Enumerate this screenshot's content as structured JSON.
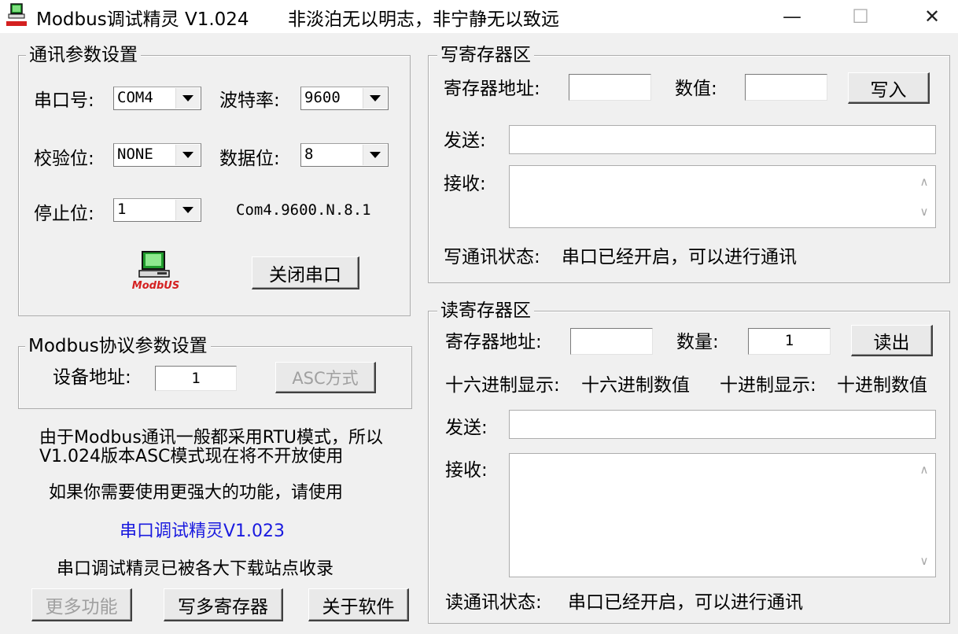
{
  "window": {
    "title": "Modbus调试精灵 V1.024",
    "motto": "非淡泊无以明志，非宁静无以致远",
    "minimize_symbol": "—",
    "maximize_symbol": "☐",
    "close_symbol": "✕"
  },
  "comm": {
    "legend": "通讯参数设置",
    "port_label": "串口号:",
    "port_value": "COM4",
    "baud_label": "波特率:",
    "baud_value": "9600",
    "parity_label": "校验位:",
    "parity_value": "NONE",
    "databits_label": "数据位:",
    "databits_value": "8",
    "stopbits_label": "停止位:",
    "stopbits_value": "1",
    "summary": "Com4.9600.N.8.1",
    "logo_text": "ModbUS",
    "close_port_label": "关闭串口"
  },
  "protocol": {
    "legend": "Modbus协议参数设置",
    "device_addr_label": "设备地址:",
    "device_addr_value": "1",
    "asc_button_label": "ASC方式"
  },
  "notes": {
    "line1": "由于Modbus通讯一般都采用RTU模式，所以",
    "line2": "V1.024版本ASC模式现在将不开放使用",
    "line3": "如果你需要使用更强大的功能，请使用",
    "link": "串口调试精灵V1.023",
    "line4": "串口调试精灵已被各大下载站点收录"
  },
  "bottom_buttons": {
    "more": "更多功能",
    "write_multi": "写多寄存器",
    "about": "关于软件"
  },
  "write": {
    "legend": "写寄存器区",
    "addr_label": "寄存器地址:",
    "addr_value": "",
    "value_label": "数值:",
    "value_value": "",
    "write_button": "写入",
    "send_label": "发送:",
    "send_value": "",
    "recv_label": "接收:",
    "recv_value": "",
    "status_label": "写通讯状态:",
    "status_value": "串口已经开启，可以进行通讯"
  },
  "read": {
    "legend": "读寄存器区",
    "addr_label": "寄存器地址:",
    "addr_value": "",
    "count_label": "数量:",
    "count_value": "1",
    "read_button": "读出",
    "hex_label": "十六进制显示:",
    "hex_value": "十六进制数值",
    "dec_label": "十进制显示:",
    "dec_value": "十进制数值",
    "send_label": "发送:",
    "send_value": "",
    "recv_label": "接收:",
    "recv_value": "",
    "status_label": "读通讯状态:",
    "status_value": "串口已经开启，可以进行通讯"
  },
  "colors": {
    "link": "#1a1adf",
    "logo_red": "#d42020",
    "logo_green": "#1f9a2c"
  },
  "scroll_up": "∧",
  "scroll_down": "∨"
}
